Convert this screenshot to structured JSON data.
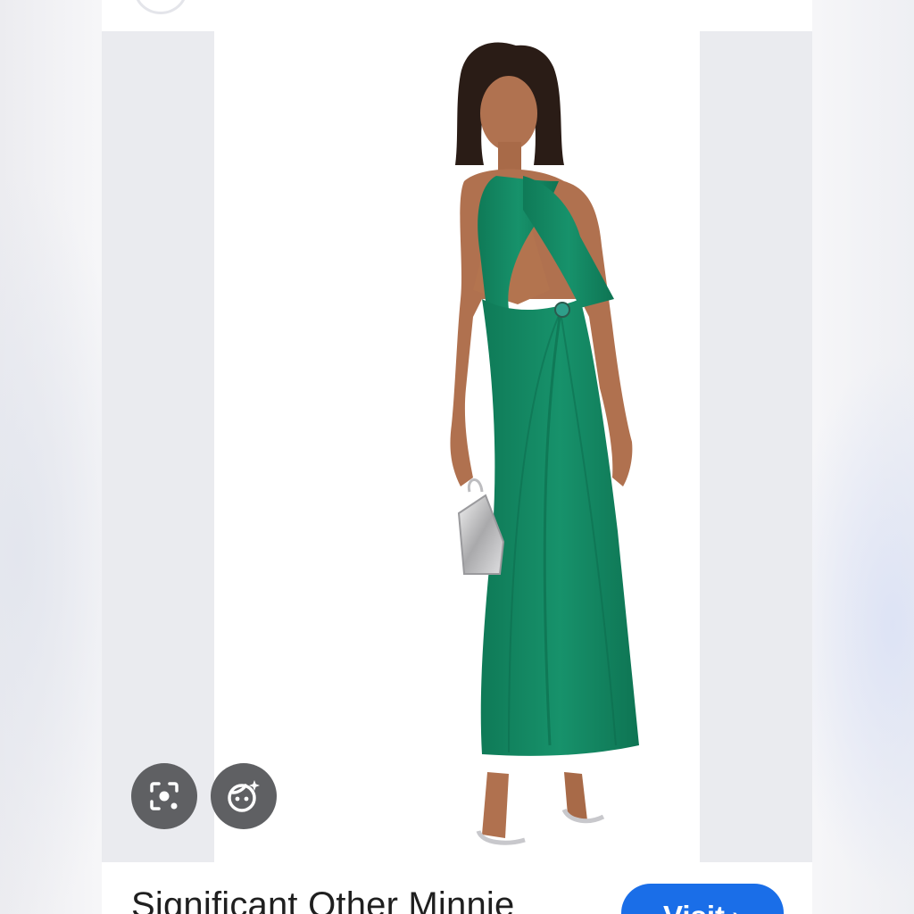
{
  "product": {
    "title": "Significant Other Minnie",
    "image_alt": "Model wearing green halter cut-out maxi dress holding a silver bag"
  },
  "actions": {
    "visit_label": "Visit",
    "visit_chevron": "›",
    "lens_icon": "lens-search-icon",
    "magic_icon": "magic-edit-face-icon"
  },
  "colors": {
    "dress": "#138a64",
    "accent": "#1a6ee8",
    "overlay_button": "#5f6063"
  }
}
